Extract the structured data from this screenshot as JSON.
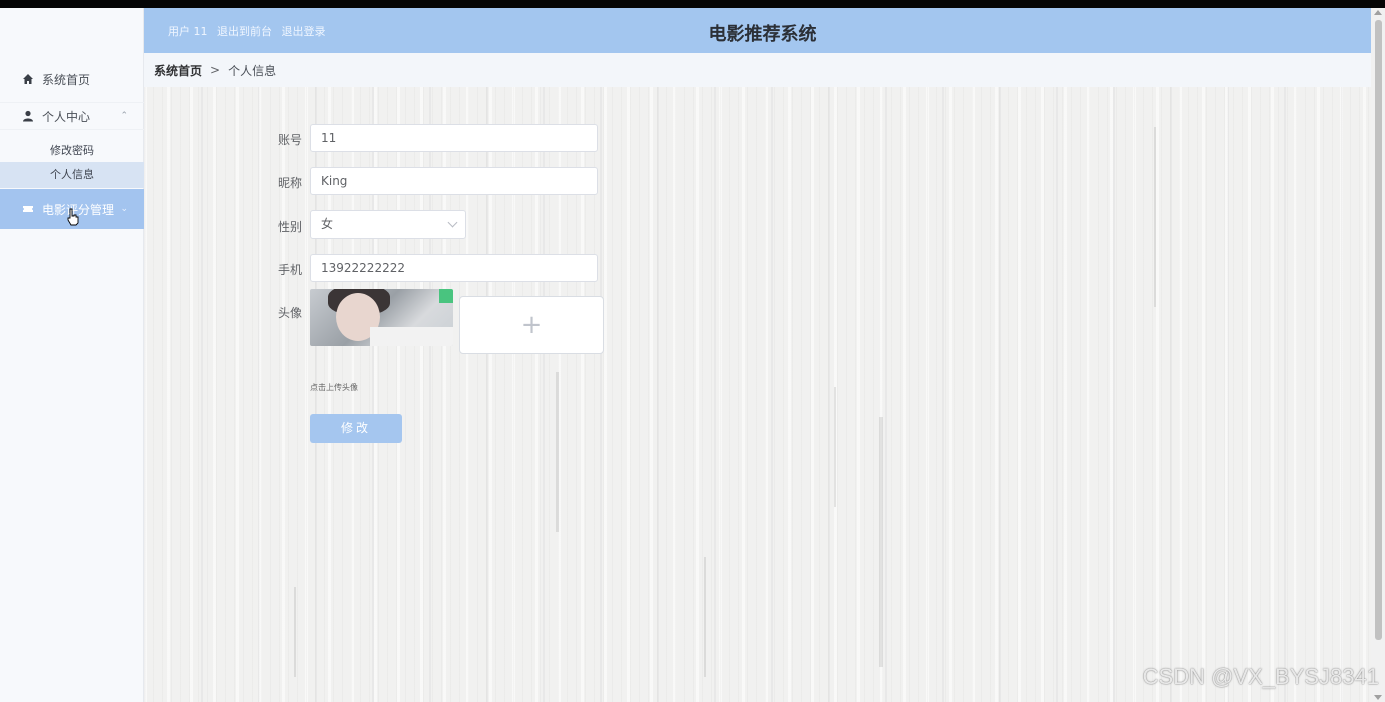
{
  "header": {
    "user_label": "用户 11",
    "to_front": "退出到前台",
    "logout": "退出登录",
    "title": "电影推荐系统"
  },
  "sidebar": {
    "home": "系统首页",
    "personal_center": "个人中心",
    "change_password": "修改密码",
    "personal_info": "个人信息",
    "movie_review": "电影评分管理"
  },
  "breadcrumb": {
    "home": "系统首页",
    "separator": ">",
    "current": "个人信息"
  },
  "form": {
    "account_label": "账号",
    "account_value": "11",
    "nickname_label": "昵称",
    "nickname_value": "King",
    "gender_label": "性别",
    "gender_value": "女",
    "phone_label": "手机",
    "phone_value": "13922222222",
    "avatar_label": "头像",
    "upload_plus": "+",
    "upload_tip": "点击上传头像",
    "submit_label": "修改"
  },
  "watermark": "CSDN @VX_BYSJ8341",
  "colors": {
    "header_bg": "#a3c6ef",
    "active_menu": "#a3c4ef",
    "submit_button": "#a5c6ef"
  }
}
